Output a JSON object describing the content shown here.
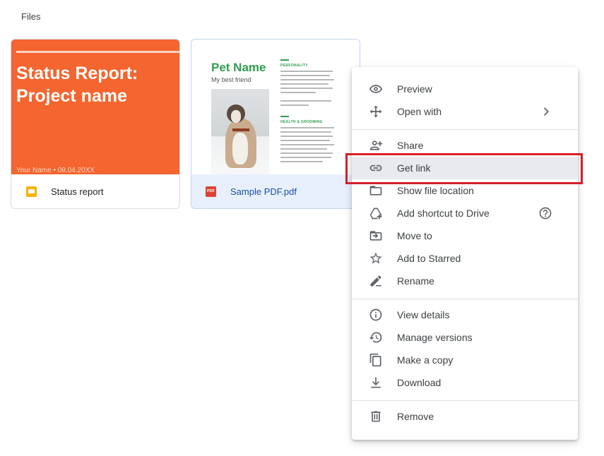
{
  "section": {
    "label": "Files"
  },
  "files": [
    {
      "name": "Status report",
      "icon": "slides-icon",
      "thumbnail": {
        "title": "Status Report:\nProject name",
        "subtitle": "Your Name • 09.04.20XX",
        "bg_color": "#f4652f"
      }
    },
    {
      "name": "Sample PDF.pdf",
      "icon": "pdf-icon",
      "icon_text": "PDF",
      "selected": true,
      "thumbnail": {
        "title": "Pet Name",
        "subtitle": "My best friend",
        "heading_1": "PERSONALITY",
        "heading_2": "HEALTH & GROOMING",
        "accent_color": "#2e9e4d"
      }
    }
  ],
  "context_menu": {
    "groups": [
      [
        {
          "label": "Preview",
          "icon": "eye-icon"
        },
        {
          "label": "Open with",
          "icon": "move-arrows-icon",
          "trailing_icon": "chevron-right-icon"
        }
      ],
      [
        {
          "label": "Share",
          "icon": "person-add-icon"
        },
        {
          "label": "Get link",
          "icon": "link-icon",
          "highlighted": true
        },
        {
          "label": "Show file location",
          "icon": "folder-icon"
        },
        {
          "label": "Add shortcut to Drive",
          "icon": "drive-shortcut-icon",
          "trailing_icon": "help-circle-icon"
        },
        {
          "label": "Move to",
          "icon": "move-to-folder-icon"
        },
        {
          "label": "Add to Starred",
          "icon": "star-icon"
        },
        {
          "label": "Rename",
          "icon": "pencil-icon"
        }
      ],
      [
        {
          "label": "View details",
          "icon": "info-icon"
        },
        {
          "label": "Manage versions",
          "icon": "history-icon"
        },
        {
          "label": "Make a copy",
          "icon": "copy-icon"
        },
        {
          "label": "Download",
          "icon": "download-icon"
        }
      ],
      [
        {
          "label": "Remove",
          "icon": "trash-icon"
        }
      ]
    ]
  },
  "colors": {
    "highlight_border": "#d81e2a",
    "menu_hover": "#e8eaed",
    "selected_card": "#e8f0fe"
  }
}
